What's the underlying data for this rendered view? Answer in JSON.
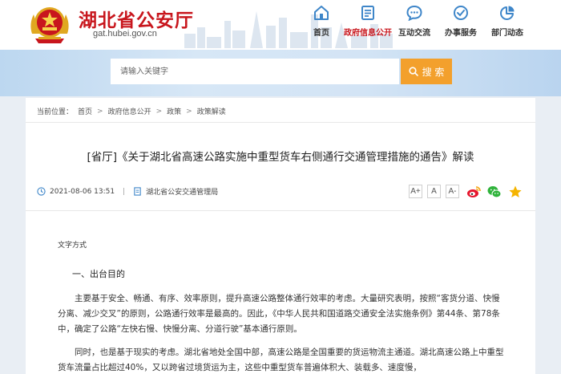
{
  "header": {
    "site_title": "湖北省公安厅",
    "site_url": "gat.hubei.gov.cn",
    "nav": [
      {
        "label": "首页",
        "icon": "home-icon"
      },
      {
        "label": "政府信息公开",
        "icon": "document-list-icon",
        "active": true
      },
      {
        "label": "互动交流",
        "icon": "chat-icon"
      },
      {
        "label": "办事服务",
        "icon": "service-icon"
      },
      {
        "label": "部门动态",
        "icon": "pie-chart-icon"
      }
    ]
  },
  "search": {
    "placeholder": "请输入关键字",
    "button_label": "搜 索"
  },
  "breadcrumb": {
    "prefix": "当前位置：",
    "items": [
      "首页",
      "政府信息公开",
      "政策",
      "政策解读"
    ],
    "separator": ">"
  },
  "article": {
    "title": "[省厅]《关于湖北省高速公路实施中重型货车右侧通行交通管理措施的通告》解读",
    "date": "2021-08-06 13:51",
    "meta_separator": "|",
    "source": "湖北省公安交通管理局",
    "font_sizes": [
      "A+",
      "A",
      "A-"
    ],
    "doc_type": "文字方式",
    "section_heading": "一、出台目的",
    "paragraphs": [
      "主要基于安全、畅通、有序、效率原则，提升高速公路整体通行效率的考虑。大量研究表明，按照“客货分道、快慢分离、减少交叉”的原则，公路通行效率是最高的。因此，《中华人民共和国道路交通安全法实施条例》第44条、第78条中，确定了公路“左快右慢、快慢分离、分道行驶”基本通行原则。",
      "同时，也是基于现实的考虑。湖北省地处全国中部，高速公路是全国重要的货运物流主通道。湖北高速公路上中重型货车流量占比超过40%，又以跨省过境货运为主，这些中重型货车普遍体积大、装载多、速度慢，"
    ]
  },
  "colors": {
    "brand_red": "#c8161d",
    "search_orange": "#f3a02c",
    "icon_blue": "#3e86c9"
  }
}
